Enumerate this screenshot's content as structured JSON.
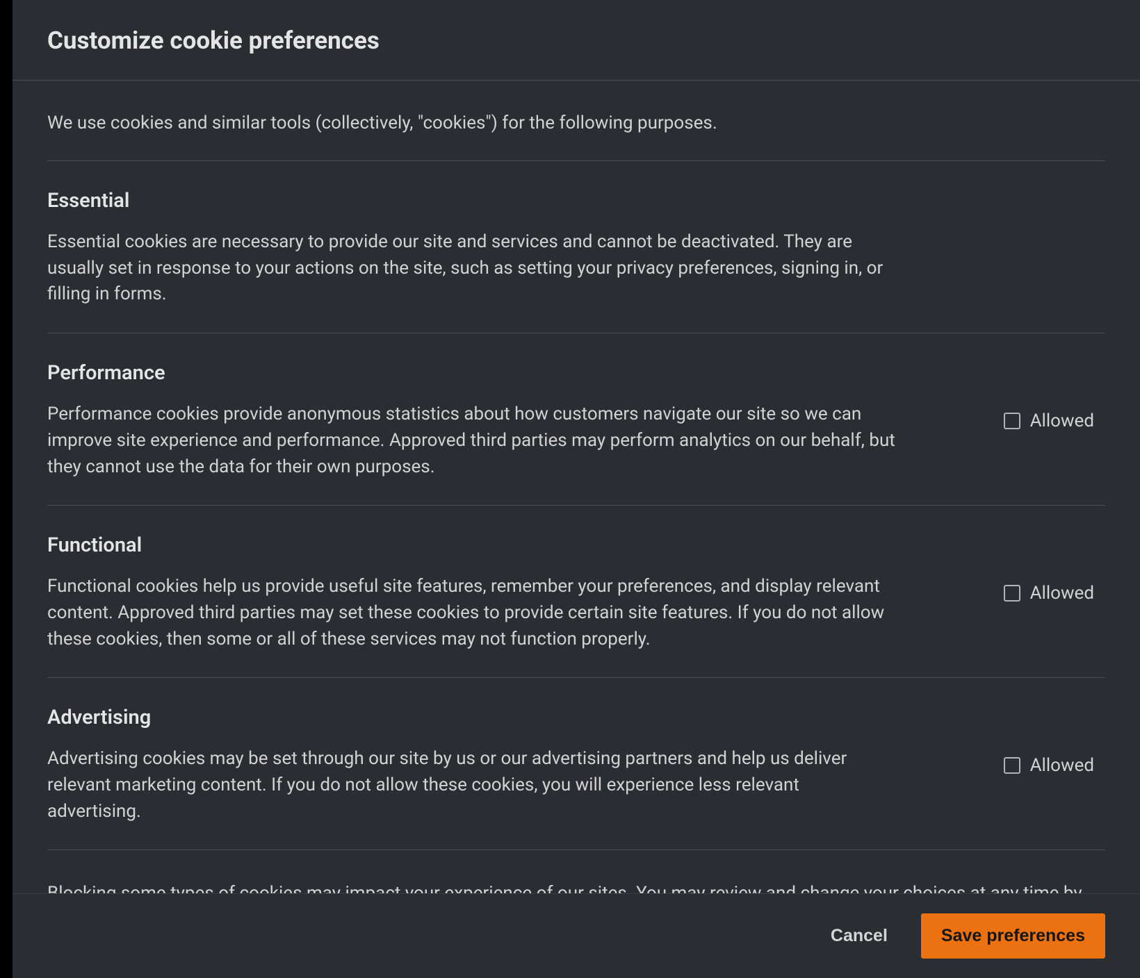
{
  "modal": {
    "title": "Customize cookie preferences",
    "intro": "We use cookies and similar tools (collectively, \"cookies\") for the following purposes.",
    "sections": [
      {
        "title": "Essential",
        "desc": "Essential cookies are necessary to provide our site and services and cannot be deactivated. They are usually set in response to your actions on the site, such as setting your privacy preferences, signing in, or filling in forms.",
        "hasToggle": false
      },
      {
        "title": "Performance",
        "desc": "Performance cookies provide anonymous statistics about how customers navigate our site so we can improve site experience and performance. Approved third parties may perform analytics on our behalf, but they cannot use the data for their own purposes.",
        "hasToggle": true,
        "toggleLabel": "Allowed"
      },
      {
        "title": "Functional",
        "desc": "Functional cookies help us provide useful site features, remember your preferences, and display relevant content. Approved third parties may set these cookies to provide certain site features. If you do not allow these cookies, then some or all of these services may not function properly.",
        "hasToggle": true,
        "toggleLabel": "Allowed"
      },
      {
        "title": "Advertising",
        "desc": "Advertising cookies may be set through our site by us or our advertising partners and help us deliver relevant marketing content. If you do not allow these cookies, you will experience less relevant advertising.",
        "hasToggle": true,
        "toggleLabel": "Allowed"
      }
    ],
    "footerText": "Blocking some types of cookies may impact your experience of our sites. You may review and change your choices at any time by selecting",
    "buttons": {
      "cancel": "Cancel",
      "save": "Save preferences"
    }
  }
}
